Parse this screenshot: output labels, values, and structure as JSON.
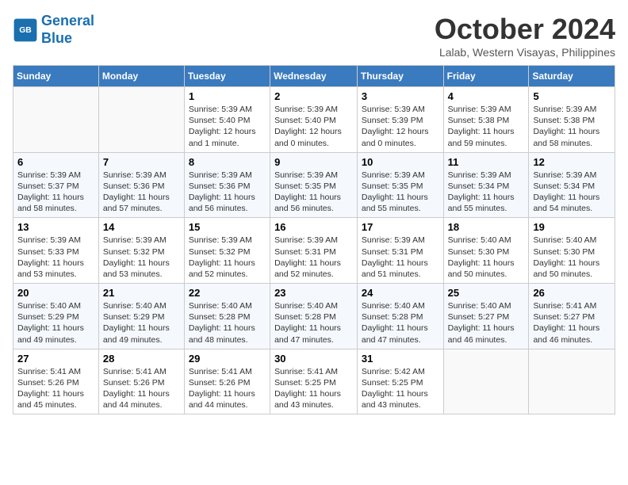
{
  "logo": {
    "line1": "General",
    "line2": "Blue"
  },
  "title": "October 2024",
  "subtitle": "Lalab, Western Visayas, Philippines",
  "days_of_week": [
    "Sunday",
    "Monday",
    "Tuesday",
    "Wednesday",
    "Thursday",
    "Friday",
    "Saturday"
  ],
  "weeks": [
    [
      {
        "day": "",
        "info": ""
      },
      {
        "day": "",
        "info": ""
      },
      {
        "day": "1",
        "info": "Sunrise: 5:39 AM\nSunset: 5:40 PM\nDaylight: 12 hours\nand 1 minute."
      },
      {
        "day": "2",
        "info": "Sunrise: 5:39 AM\nSunset: 5:40 PM\nDaylight: 12 hours\nand 0 minutes."
      },
      {
        "day": "3",
        "info": "Sunrise: 5:39 AM\nSunset: 5:39 PM\nDaylight: 12 hours\nand 0 minutes."
      },
      {
        "day": "4",
        "info": "Sunrise: 5:39 AM\nSunset: 5:38 PM\nDaylight: 11 hours\nand 59 minutes."
      },
      {
        "day": "5",
        "info": "Sunrise: 5:39 AM\nSunset: 5:38 PM\nDaylight: 11 hours\nand 58 minutes."
      }
    ],
    [
      {
        "day": "6",
        "info": "Sunrise: 5:39 AM\nSunset: 5:37 PM\nDaylight: 11 hours\nand 58 minutes."
      },
      {
        "day": "7",
        "info": "Sunrise: 5:39 AM\nSunset: 5:36 PM\nDaylight: 11 hours\nand 57 minutes."
      },
      {
        "day": "8",
        "info": "Sunrise: 5:39 AM\nSunset: 5:36 PM\nDaylight: 11 hours\nand 56 minutes."
      },
      {
        "day": "9",
        "info": "Sunrise: 5:39 AM\nSunset: 5:35 PM\nDaylight: 11 hours\nand 56 minutes."
      },
      {
        "day": "10",
        "info": "Sunrise: 5:39 AM\nSunset: 5:35 PM\nDaylight: 11 hours\nand 55 minutes."
      },
      {
        "day": "11",
        "info": "Sunrise: 5:39 AM\nSunset: 5:34 PM\nDaylight: 11 hours\nand 55 minutes."
      },
      {
        "day": "12",
        "info": "Sunrise: 5:39 AM\nSunset: 5:34 PM\nDaylight: 11 hours\nand 54 minutes."
      }
    ],
    [
      {
        "day": "13",
        "info": "Sunrise: 5:39 AM\nSunset: 5:33 PM\nDaylight: 11 hours\nand 53 minutes."
      },
      {
        "day": "14",
        "info": "Sunrise: 5:39 AM\nSunset: 5:32 PM\nDaylight: 11 hours\nand 53 minutes."
      },
      {
        "day": "15",
        "info": "Sunrise: 5:39 AM\nSunset: 5:32 PM\nDaylight: 11 hours\nand 52 minutes."
      },
      {
        "day": "16",
        "info": "Sunrise: 5:39 AM\nSunset: 5:31 PM\nDaylight: 11 hours\nand 52 minutes."
      },
      {
        "day": "17",
        "info": "Sunrise: 5:39 AM\nSunset: 5:31 PM\nDaylight: 11 hours\nand 51 minutes."
      },
      {
        "day": "18",
        "info": "Sunrise: 5:40 AM\nSunset: 5:30 PM\nDaylight: 11 hours\nand 50 minutes."
      },
      {
        "day": "19",
        "info": "Sunrise: 5:40 AM\nSunset: 5:30 PM\nDaylight: 11 hours\nand 50 minutes."
      }
    ],
    [
      {
        "day": "20",
        "info": "Sunrise: 5:40 AM\nSunset: 5:29 PM\nDaylight: 11 hours\nand 49 minutes."
      },
      {
        "day": "21",
        "info": "Sunrise: 5:40 AM\nSunset: 5:29 PM\nDaylight: 11 hours\nand 49 minutes."
      },
      {
        "day": "22",
        "info": "Sunrise: 5:40 AM\nSunset: 5:28 PM\nDaylight: 11 hours\nand 48 minutes."
      },
      {
        "day": "23",
        "info": "Sunrise: 5:40 AM\nSunset: 5:28 PM\nDaylight: 11 hours\nand 47 minutes."
      },
      {
        "day": "24",
        "info": "Sunrise: 5:40 AM\nSunset: 5:28 PM\nDaylight: 11 hours\nand 47 minutes."
      },
      {
        "day": "25",
        "info": "Sunrise: 5:40 AM\nSunset: 5:27 PM\nDaylight: 11 hours\nand 46 minutes."
      },
      {
        "day": "26",
        "info": "Sunrise: 5:41 AM\nSunset: 5:27 PM\nDaylight: 11 hours\nand 46 minutes."
      }
    ],
    [
      {
        "day": "27",
        "info": "Sunrise: 5:41 AM\nSunset: 5:26 PM\nDaylight: 11 hours\nand 45 minutes."
      },
      {
        "day": "28",
        "info": "Sunrise: 5:41 AM\nSunset: 5:26 PM\nDaylight: 11 hours\nand 44 minutes."
      },
      {
        "day": "29",
        "info": "Sunrise: 5:41 AM\nSunset: 5:26 PM\nDaylight: 11 hours\nand 44 minutes."
      },
      {
        "day": "30",
        "info": "Sunrise: 5:41 AM\nSunset: 5:25 PM\nDaylight: 11 hours\nand 43 minutes."
      },
      {
        "day": "31",
        "info": "Sunrise: 5:42 AM\nSunset: 5:25 PM\nDaylight: 11 hours\nand 43 minutes."
      },
      {
        "day": "",
        "info": ""
      },
      {
        "day": "",
        "info": ""
      }
    ]
  ]
}
